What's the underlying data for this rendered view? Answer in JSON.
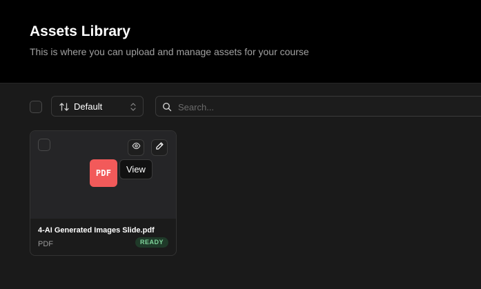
{
  "header": {
    "title": "Assets Library",
    "subtitle": "This is where you can upload and manage assets for your course"
  },
  "toolbar": {
    "sort": {
      "label": "Default",
      "icon": "sort-arrows-icon"
    },
    "search": {
      "placeholder": "Search...",
      "value": ""
    }
  },
  "assets": [
    {
      "name": "4-AI Generated Images Slide.pdf",
      "type": "PDF",
      "status": "READY",
      "badge_label": "PDF",
      "badge_color": "#f25a5a",
      "tooltip": "View"
    }
  ],
  "colors": {
    "header_bg": "#000000",
    "page_bg": "#1a1a1a",
    "ready_bg": "#1f3a29",
    "ready_text": "#7fd59b"
  }
}
